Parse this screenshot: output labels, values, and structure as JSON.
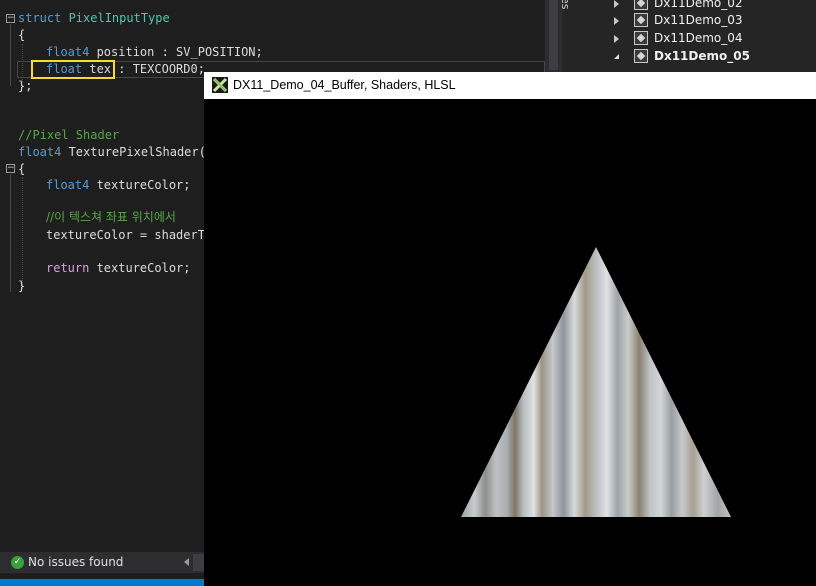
{
  "editor": {
    "lines": [
      {
        "kw": "struct",
        "rest": " PixelInputType"
      },
      {
        "text": "{"
      },
      {
        "ty": "float4",
        "rest": " position : SV_POSITION;"
      },
      {
        "ty": "float",
        "mid": " tex",
        "rest": " : TEXCOORD0;"
      },
      {
        "text": "};"
      },
      {
        "cm": "//Pixel Shader"
      },
      {
        "ty": "float4",
        "fn": " TexturePixelShader(F"
      },
      {
        "text": "{"
      },
      {
        "ty": "float4",
        "rest": " textureColor;"
      },
      {
        "cm": "//이 텍스쳐 좌표 위치에서"
      },
      {
        "text": "textureColor = shaderTe"
      },
      {
        "ret": "return",
        "rest": " textureColor;"
      },
      {
        "text": "}"
      }
    ],
    "fold_expanded_glyph": "−"
  },
  "side_tab": {
    "label": "es"
  },
  "solution_explorer": {
    "items": [
      {
        "label": "Dx11Demo_02",
        "expanded": false,
        "bold": false
      },
      {
        "label": "Dx11Demo_03",
        "expanded": false,
        "bold": false
      },
      {
        "label": "Dx11Demo_04",
        "expanded": false,
        "bold": false
      },
      {
        "label": "Dx11Demo_05",
        "expanded": true,
        "bold": true
      }
    ]
  },
  "status_bar": {
    "text": "No issues found",
    "icon": "check-circle-icon",
    "color": "#3aa03a"
  },
  "dx_window": {
    "title": "DX11_Demo_04_Buffer, Shaders, HLSL",
    "app_icon": "directx-x-icon",
    "background": "#000000"
  },
  "colors": {
    "editor_bg": "#1e1e1e",
    "keyword": "#569cd6",
    "comment": "#57a64a",
    "highlight_box": "#f6dc32",
    "accent_blue": "#007acc"
  }
}
